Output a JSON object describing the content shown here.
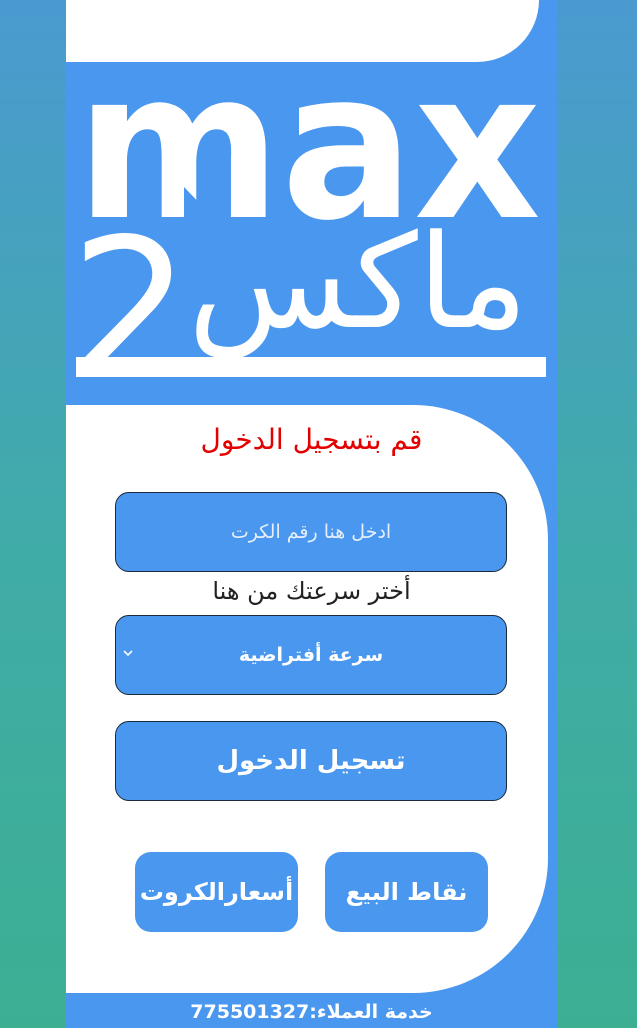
{
  "brand": {
    "logo_latin": "max",
    "logo_arabic": "ماكس",
    "logo_number": "2"
  },
  "login": {
    "title": "قم بتسجيل الدخول",
    "card_placeholder": "ادخل هنا رقم الكرت",
    "card_value": "",
    "speed_label": "أختر سرعتك من هنا",
    "speed_selected": "سرعة أفتراضية",
    "submit_label": "تسجيل الدخول"
  },
  "actions": {
    "points_of_sale": "نقاط البيع",
    "card_prices": "أسعارالكروت"
  },
  "footer": {
    "customer_service": "خدمة العملاء:775501327"
  },
  "colors": {
    "accent": "#4a97ef",
    "title": "#e30000",
    "background_top": "#4a9ad0",
    "background_bottom": "#3caf93"
  },
  "icons": {
    "select_arrow": "chevron-down-icon"
  }
}
